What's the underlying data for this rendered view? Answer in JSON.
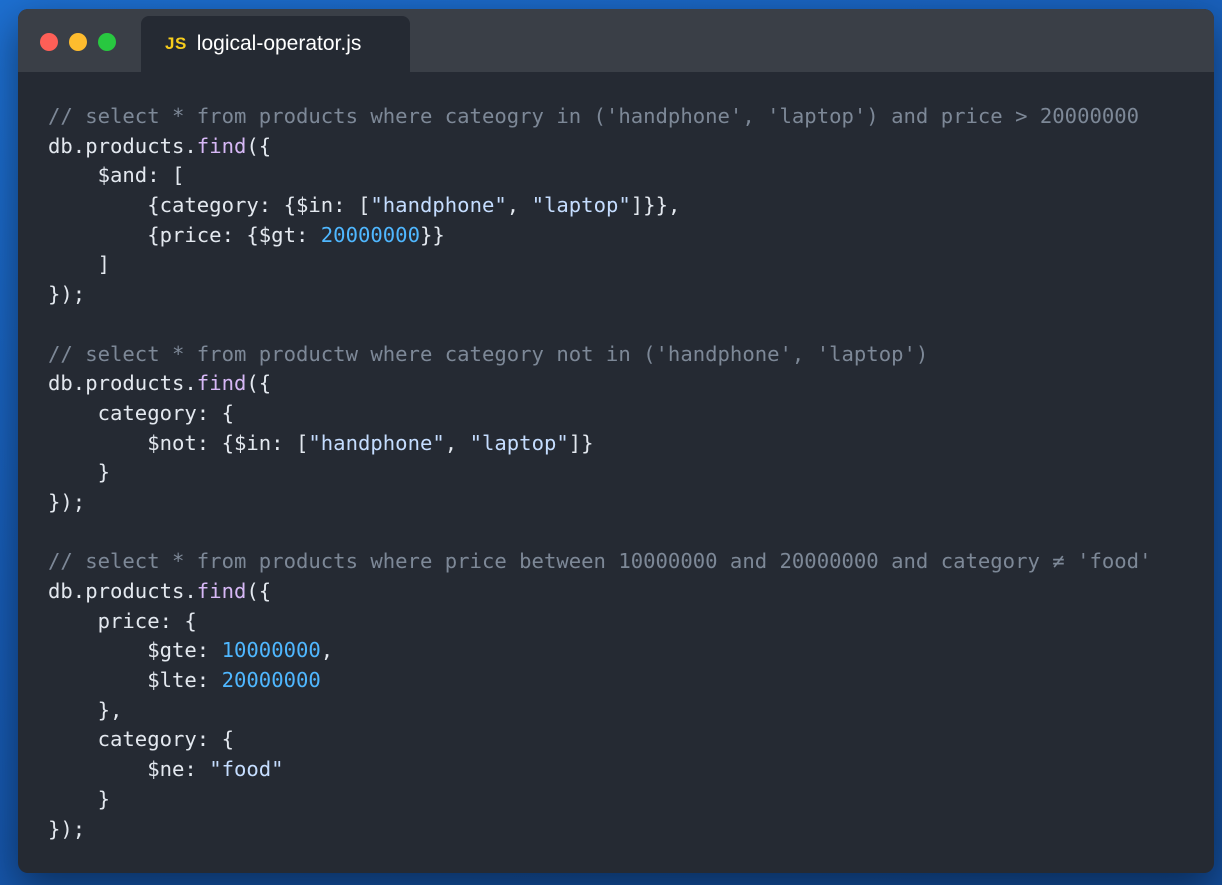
{
  "window": {
    "controls": [
      "close",
      "minimize",
      "maximize"
    ],
    "tab": {
      "icon_text": "JS",
      "icon": "javascript-file-icon",
      "filename": "logical-operator.js"
    }
  },
  "colors": {
    "background": "#1d6fd0",
    "editor": "#252a33",
    "titlebar": "#3a3f47",
    "comment": "#7d8897",
    "function": "#d7b8f6",
    "string": "#c5ddff",
    "number": "#4fb7ff",
    "text": "#e3e8ef"
  },
  "code": [
    [
      [
        "c",
        "// select * from products where cateogry in ('handphone', 'laptop') and price > 20000000"
      ]
    ],
    [
      [
        "p",
        "db.products."
      ],
      [
        "f",
        "find"
      ],
      [
        "p",
        "({"
      ]
    ],
    [
      [
        "p",
        "    $and: ["
      ]
    ],
    [
      [
        "p",
        "        {category: {$in: ["
      ],
      [
        "s",
        "\"handphone\""
      ],
      [
        "p",
        ", "
      ],
      [
        "s",
        "\"laptop\""
      ],
      [
        "p",
        "]}},"
      ]
    ],
    [
      [
        "p",
        "        {price: {$gt: "
      ],
      [
        "n",
        "20000000"
      ],
      [
        "p",
        "}}"
      ]
    ],
    [
      [
        "p",
        "    ]"
      ]
    ],
    [
      [
        "p",
        "});"
      ]
    ],
    [],
    [
      [
        "c",
        "// select * from productw where category not in ('handphone', 'laptop')"
      ]
    ],
    [
      [
        "p",
        "db.products."
      ],
      [
        "f",
        "find"
      ],
      [
        "p",
        "({"
      ]
    ],
    [
      [
        "p",
        "    category: {"
      ]
    ],
    [
      [
        "p",
        "        $not: {$in: ["
      ],
      [
        "s",
        "\"handphone\""
      ],
      [
        "p",
        ", "
      ],
      [
        "s",
        "\"laptop\""
      ],
      [
        "p",
        "]}"
      ]
    ],
    [
      [
        "p",
        "    }"
      ]
    ],
    [
      [
        "p",
        "});"
      ]
    ],
    [],
    [
      [
        "c",
        "// select * from products where price between 10000000 and 20000000 and category ≠ 'food'"
      ]
    ],
    [
      [
        "p",
        "db.products."
      ],
      [
        "f",
        "find"
      ],
      [
        "p",
        "({"
      ]
    ],
    [
      [
        "p",
        "    price: {"
      ]
    ],
    [
      [
        "p",
        "        $gte: "
      ],
      [
        "n",
        "10000000"
      ],
      [
        "p",
        ","
      ]
    ],
    [
      [
        "p",
        "        $lte: "
      ],
      [
        "n",
        "20000000"
      ]
    ],
    [
      [
        "p",
        "    },"
      ]
    ],
    [
      [
        "p",
        "    category: {"
      ]
    ],
    [
      [
        "p",
        "        $ne: "
      ],
      [
        "s",
        "\"food\""
      ]
    ],
    [
      [
        "p",
        "    }"
      ]
    ],
    [
      [
        "p",
        "});"
      ]
    ]
  ]
}
